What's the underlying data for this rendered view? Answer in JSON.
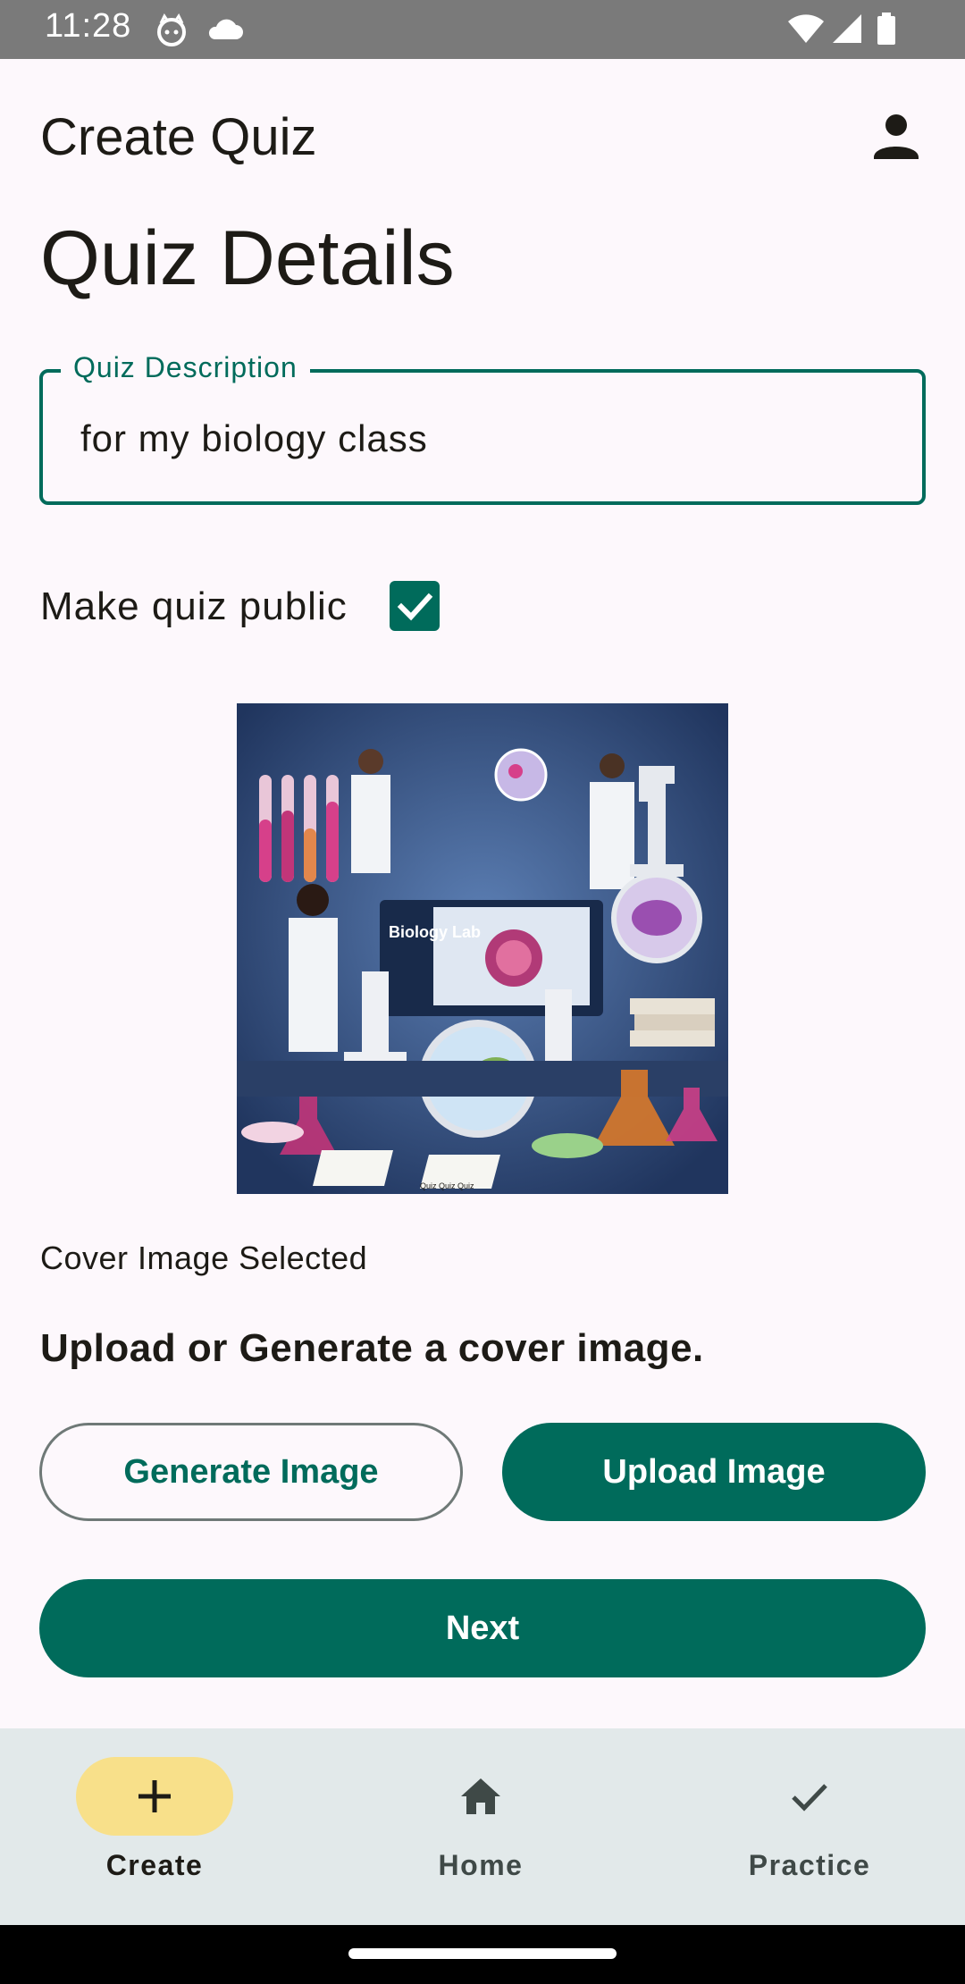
{
  "status_bar": {
    "time": "11:28"
  },
  "app_bar": {
    "title": "Create Quiz"
  },
  "section_title": "Quiz Details",
  "description_field": {
    "label": "Quiz Description",
    "value": "for my biology class"
  },
  "public_toggle": {
    "label": "Make quiz public",
    "checked": true
  },
  "cover_image": {
    "caption_text": "Biology Lab",
    "watermark_text": "Quiz Quiz Quiz",
    "status": "Cover Image Selected"
  },
  "upload_prompt": "Upload or Generate a cover image.",
  "buttons": {
    "generate": "Generate Image",
    "upload": "Upload Image",
    "next": "Next"
  },
  "bottom_nav": [
    {
      "label": "Create",
      "icon": "plus-icon",
      "active": true
    },
    {
      "label": "Home",
      "icon": "home-icon",
      "active": false
    },
    {
      "label": "Practice",
      "icon": "check-icon",
      "active": false
    }
  ],
  "colors": {
    "primary": "#006b5b",
    "background": "#fdf8fc",
    "nav_background": "#e2e9ea",
    "nav_active_pill": "#f8e08a",
    "status_bar": "#7a7a7a"
  }
}
